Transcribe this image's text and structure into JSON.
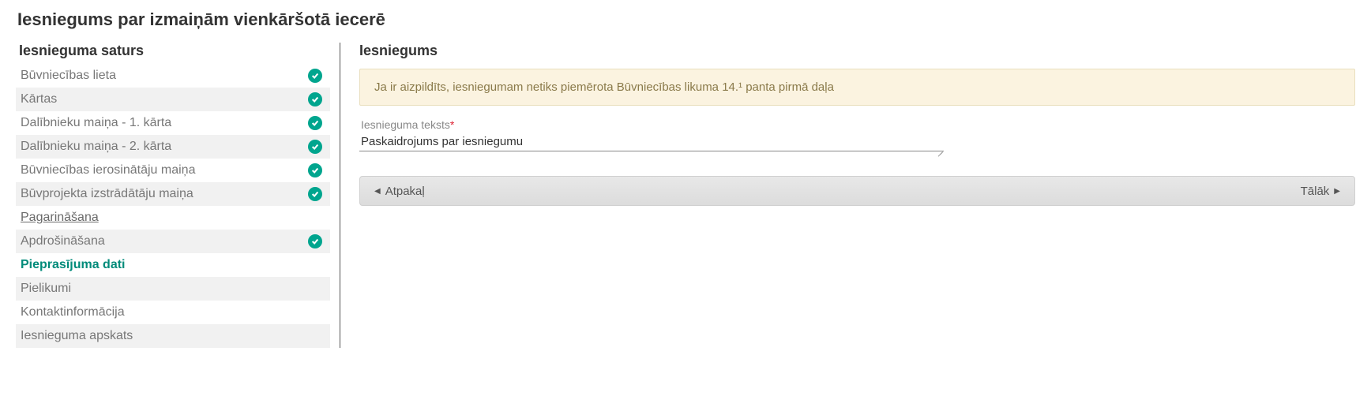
{
  "page_title": "Iesniegums par izmaiņām vienkāršotā iecerē",
  "sidebar": {
    "heading": "Iesnieguma saturs",
    "items": [
      {
        "label": "Būvniecības lieta",
        "check": true,
        "striped": false,
        "active": false,
        "underline": false
      },
      {
        "label": "Kārtas",
        "check": true,
        "striped": true,
        "active": false,
        "underline": false
      },
      {
        "label": "Dalībnieku maiņa - 1. kārta",
        "check": true,
        "striped": false,
        "active": false,
        "underline": false
      },
      {
        "label": "Dalībnieku maiņa - 2. kārta",
        "check": true,
        "striped": true,
        "active": false,
        "underline": false
      },
      {
        "label": "Būvniecības ierosinātāju maiņa",
        "check": true,
        "striped": false,
        "active": false,
        "underline": false
      },
      {
        "label": "Būvprojekta izstrādātāju maiņa",
        "check": true,
        "striped": true,
        "active": false,
        "underline": false
      },
      {
        "label": "Pagarināšana",
        "check": false,
        "striped": false,
        "active": false,
        "underline": true
      },
      {
        "label": "Apdrošināšana",
        "check": true,
        "striped": true,
        "active": false,
        "underline": false
      },
      {
        "label": "Pieprasījuma dati",
        "check": false,
        "striped": false,
        "active": true,
        "underline": false
      },
      {
        "label": "Pielikumi",
        "check": false,
        "striped": true,
        "active": false,
        "underline": false
      },
      {
        "label": "Kontaktinformācija",
        "check": false,
        "striped": false,
        "active": false,
        "underline": false
      },
      {
        "label": "Iesnieguma apskats",
        "check": false,
        "striped": true,
        "active": false,
        "underline": false
      }
    ]
  },
  "main": {
    "heading": "Iesniegums",
    "info_banner": "Ja ir aizpildīts, iesniegumam netiks piemērota Būvniecības likuma 14.¹ panta pirmā daļa",
    "field_label": "Iesnieguma teksts",
    "required_mark": "*",
    "field_value": "Paskaidrojums par iesniegumu",
    "back_label": "Atpakaļ",
    "next_label": "Tālāk"
  }
}
